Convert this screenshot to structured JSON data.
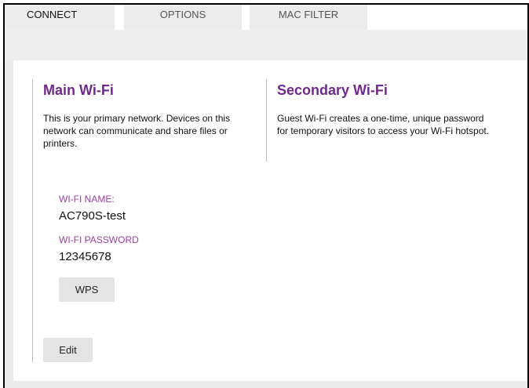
{
  "tabs": [
    {
      "label": "CONNECT",
      "active": true
    },
    {
      "label": "OPTIONS",
      "active": false
    },
    {
      "label": "MAC FILTER",
      "active": false
    }
  ],
  "main_wifi": {
    "title": "Main Wi-Fi",
    "description": "This is your primary network. Devices on this network can communicate and share files or printers.",
    "name_label": "WI-FI NAME:",
    "name_value": "AC790S-test",
    "password_label": "WI-FI PASSWORD",
    "password_value": "12345678",
    "wps_button": "WPS",
    "edit_button": "Edit"
  },
  "secondary_wifi": {
    "title": "Secondary Wi-Fi",
    "description": "Guest Wi-Fi creates a one-time, unique password for temporary visitors to access your Wi-Fi hotspot."
  },
  "colors": {
    "accent": "#6f2a8a",
    "label": "#9b3fa0",
    "background": "#ebebeb"
  }
}
